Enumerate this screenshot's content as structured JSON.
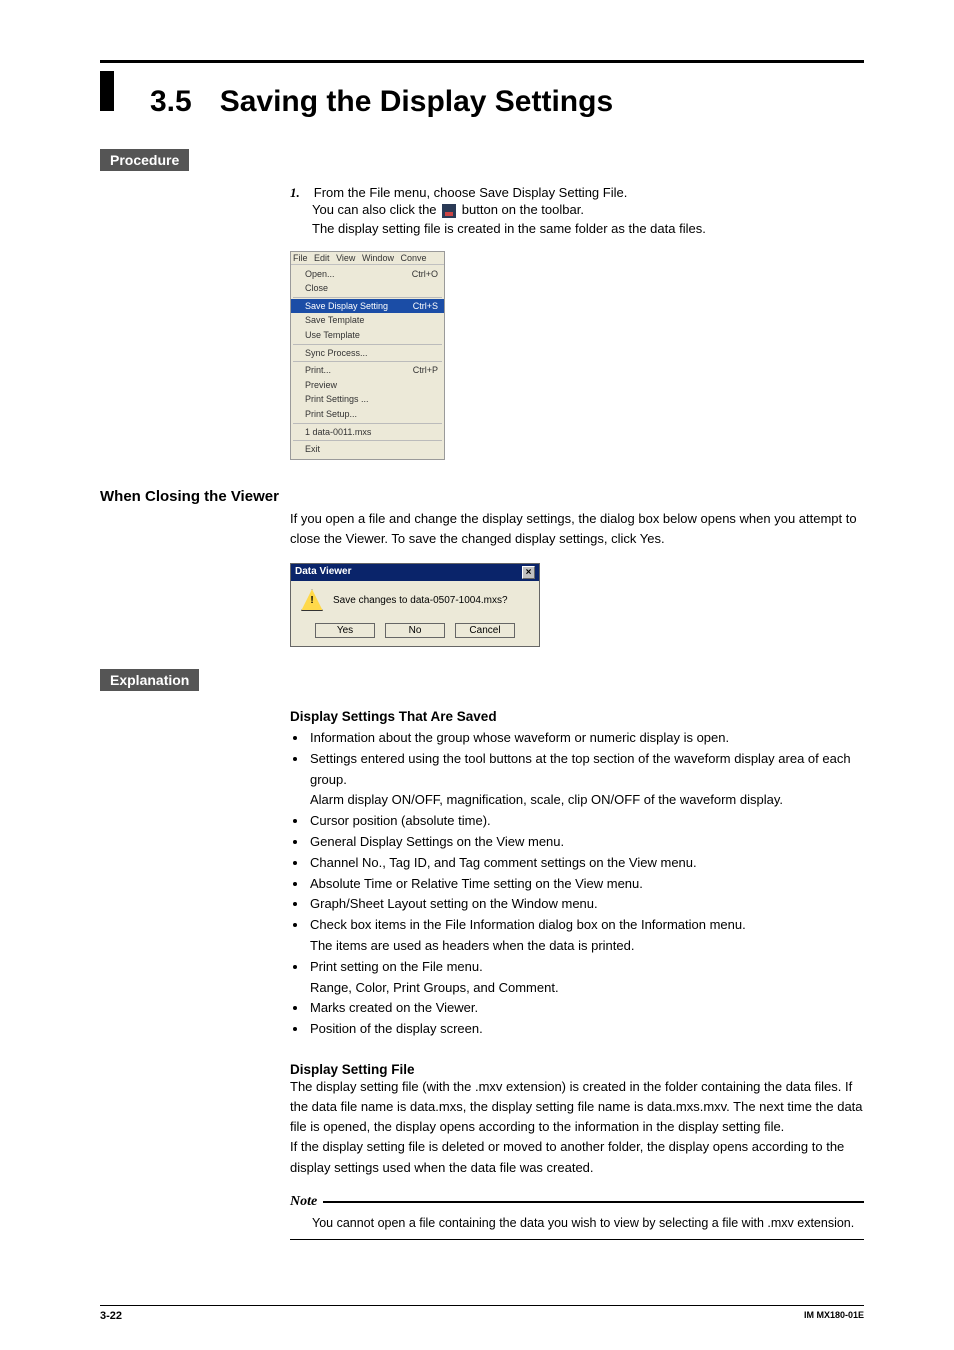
{
  "header": {
    "section_number": "3.5",
    "title": "Saving the Display Settings"
  },
  "procedure": {
    "tag": "Procedure",
    "step_number": "1.",
    "step_text": "From the File menu, choose Save Display Setting File.",
    "sub1_a": "You can also click the ",
    "sub1_b": " button on the toolbar.",
    "sub2": "The display setting file is created in the same folder as the data files.",
    "menu": {
      "bar": [
        "File",
        "Edit",
        "View",
        "Window",
        "Conve"
      ],
      "items": [
        {
          "label": "Open...",
          "accel": "Ctrl+O"
        },
        {
          "label": "Close"
        },
        {
          "sep": true
        },
        {
          "label": "Save Display Setting",
          "accel": "Ctrl+S",
          "hl": true
        },
        {
          "label": "Save Template"
        },
        {
          "label": "Use Template"
        },
        {
          "sep": true
        },
        {
          "label": "Sync Process..."
        },
        {
          "sep": true
        },
        {
          "label": "Print...",
          "accel": "Ctrl+P"
        },
        {
          "label": "Preview"
        },
        {
          "label": "Print Settings ..."
        },
        {
          "label": "Print Setup..."
        },
        {
          "sep": true
        },
        {
          "label": "1 data-0011.mxs"
        },
        {
          "sep": true
        },
        {
          "label": "Exit"
        }
      ]
    }
  },
  "closing": {
    "heading": "When Closing the Viewer",
    "para": "If you open a file and change the display settings, the dialog box below opens when you attempt to close the Viewer. To save the changed display settings, click Yes.",
    "dialog": {
      "title": "Data Viewer",
      "message": "Save changes to data-0507-1004.mxs?",
      "yes": "Yes",
      "no": "No",
      "cancel": "Cancel"
    }
  },
  "explanation": {
    "tag": "Explanation",
    "saved_heading": "Display Settings That Are Saved",
    "bullets": [
      {
        "main": "Information about the group whose waveform or numeric display is open."
      },
      {
        "main": "Settings entered using the tool buttons at the top section of the waveform display area of each group.",
        "sub": "Alarm display ON/OFF, magnification, scale, clip ON/OFF of the waveform display."
      },
      {
        "main": "Cursor position (absolute time)."
      },
      {
        "main": "General Display Settings on the View menu."
      },
      {
        "main": "Channel No., Tag ID, and Tag comment settings on the View menu."
      },
      {
        "main": "Absolute Time or Relative Time setting on the View menu."
      },
      {
        "main": "Graph/Sheet Layout setting on the Window menu."
      },
      {
        "main": "Check box items in the File Information dialog box on the Information menu.",
        "sub": "The items are used as headers when the data is printed."
      },
      {
        "main": "Print setting on the File menu.",
        "sub": "Range, Color, Print Groups, and Comment."
      },
      {
        "main": "Marks created on the Viewer."
      },
      {
        "main": "Position of the display screen."
      }
    ],
    "file_heading": "Display Setting File",
    "file_para": "The display setting file (with the .mxv extension) is created in the folder containing the data files. If the data file name is data.mxs, the display setting file name is data.mxs.mxv. The next time the data file is opened, the display opens according to the information in the display setting file.\nIf the display setting file is deleted or moved to another folder, the display opens according to the display settings used when the data file was created.",
    "note_label": "Note",
    "note_text": "You cannot open a file containing the data you wish to view by selecting a file with .mxv extension."
  },
  "footer": {
    "left": "3-22",
    "right": "IM MX180-01E"
  }
}
